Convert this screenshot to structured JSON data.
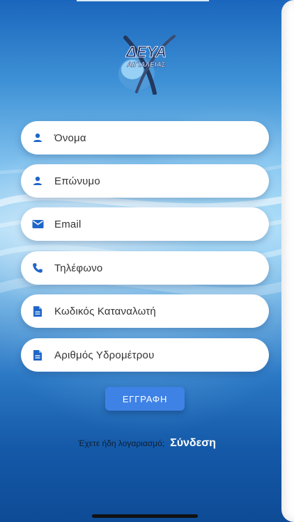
{
  "brand": {
    "logo_text_top": "ΔΕΥΑ",
    "logo_text_bottom": "ΑΙΓΙΑΛΕΙΑΣ"
  },
  "form": {
    "fields": [
      {
        "label": "Όνομα",
        "icon": "person-icon"
      },
      {
        "label": "Επώνυμο",
        "icon": "person-icon"
      },
      {
        "label": "Email",
        "icon": "email-icon"
      },
      {
        "label": "Τηλέφωνο",
        "icon": "phone-icon"
      },
      {
        "label": "Κωδικός Καταναλωτή",
        "icon": "document-icon"
      },
      {
        "label": "Αριθμός Υδρομέτρου",
        "icon": "document-icon"
      }
    ],
    "submit_label": "ΕΓΓΡΑΦΗ"
  },
  "footer": {
    "login_prompt": "Έχετε ήδη λογαριασμό;",
    "login_link": "Σύνδεση"
  },
  "colors": {
    "button": "#3f82e6",
    "icon": "#1f66c9",
    "field_bg": "#ffffff"
  }
}
